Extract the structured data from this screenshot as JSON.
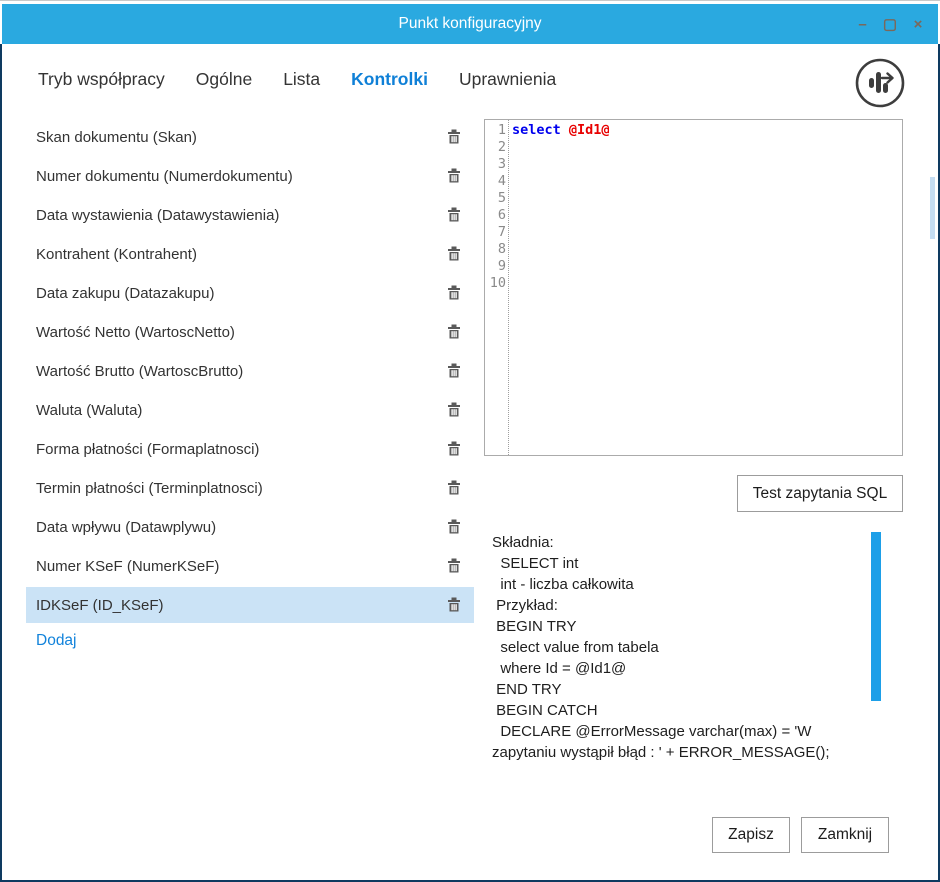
{
  "window": {
    "title": "Punkt konfiguracyjny",
    "controls": {
      "minimize": "–",
      "maximize": "▢",
      "close": "×"
    }
  },
  "tabs": [
    {
      "label": "Tryb współpracy",
      "active": false
    },
    {
      "label": "Ogólne",
      "active": false
    },
    {
      "label": "Lista",
      "active": false
    },
    {
      "label": "Kontrolki",
      "active": true
    },
    {
      "label": "Uprawnienia",
      "active": false
    }
  ],
  "fields": [
    {
      "label": "Skan dokumentu (Skan)",
      "selected": false
    },
    {
      "label": "Numer dokumentu (Numerdokumentu)",
      "selected": false
    },
    {
      "label": "Data wystawienia (Datawystawienia)",
      "selected": false
    },
    {
      "label": "Kontrahent (Kontrahent)",
      "selected": false
    },
    {
      "label": "Data zakupu (Datazakupu)",
      "selected": false
    },
    {
      "label": "Wartość Netto (WartoscNetto)",
      "selected": false
    },
    {
      "label": "Wartość Brutto (WartoscBrutto)",
      "selected": false
    },
    {
      "label": "Waluta (Waluta)",
      "selected": false
    },
    {
      "label": "Forma płatności (Formaplatnosci)",
      "selected": false
    },
    {
      "label": "Termin płatności (Terminplatnosci)",
      "selected": false
    },
    {
      "label": "Data wpływu (Datawplywu)",
      "selected": false
    },
    {
      "label": "Numer KSeF (NumerKSeF)",
      "selected": false
    },
    {
      "label": "IDKSeF (ID_KSeF)",
      "selected": true
    }
  ],
  "add_link": "Dodaj",
  "editor": {
    "line_numbers": [
      "1",
      "2",
      "3",
      "4",
      "5",
      "6",
      "7",
      "8",
      "9",
      "10"
    ],
    "keyword": "select",
    "param": " @Id1@"
  },
  "test_button": "Test zapytania SQL",
  "help": {
    "text": "Składnia:\n  SELECT int\n  int - liczba całkowita\n Przykład:\n BEGIN TRY\n  select value from tabela\n  where Id = @Id1@\n END TRY\n BEGIN CATCH\n  DECLARE @ErrorMessage varchar(max) = 'W\nzapytaniu wystąpił błąd : ' + ERROR_MESSAGE();"
  },
  "footer": {
    "save": "Zapisz",
    "close": "Zamknij"
  },
  "colors": {
    "titlebar": "#2aa9e0",
    "active_tab": "#0f80d7",
    "selected_row": "#cbe3f6",
    "frame_border": "#0e3a60",
    "scroll_thumb": "#1d9fe8",
    "keyword": "#0000ee",
    "param": "#e80000"
  }
}
